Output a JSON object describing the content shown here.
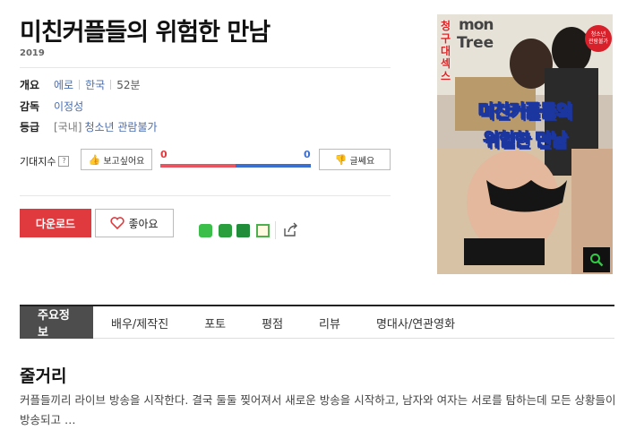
{
  "title": "미친커플들의 위험한 만남",
  "year": "2019",
  "info": {
    "overview_label": "개요",
    "genre": "에로",
    "country": "한국",
    "runtime": "52분",
    "director_label": "감독",
    "director": "이정성",
    "rating_label": "등급",
    "rating_prefix": "[국내]",
    "rating": "청소년 관람불가"
  },
  "expect": {
    "label": "기대지수",
    "help_icon": "?",
    "want_label": "보고싶어요",
    "dont_label": "글쎄요",
    "want_count": "0",
    "dont_count": "0"
  },
  "actions": {
    "download_label": "다운로드",
    "like_label": "좋아요"
  },
  "poster": {
    "vertical_text": "청구대섹스",
    "title_line1": "미친커플들의",
    "title_line2": "위험한 만남",
    "bg_text_1": "mon",
    "bg_text_2": "Tree",
    "badge_line1": "청소년",
    "badge_line2": "관람불가"
  },
  "tabs": [
    "주요정보",
    "배우/제작진",
    "포토",
    "평점",
    "리뷰",
    "명대사/연관영화"
  ],
  "section_title": "줄거리",
  "synopsis": "커플들끼리 라이브 방송을 시작한다. 결국 둘둘 찢어져서 새로운 방송을 시작하고, 남자와 여자는 서로를 탐하는데 모든 상황들이 방송되고 …",
  "colors": {
    "accent_red": "#e0393e",
    "link_blue": "#4a6db0",
    "bar_red": "#e85560",
    "bar_blue": "#3a6fd0"
  }
}
